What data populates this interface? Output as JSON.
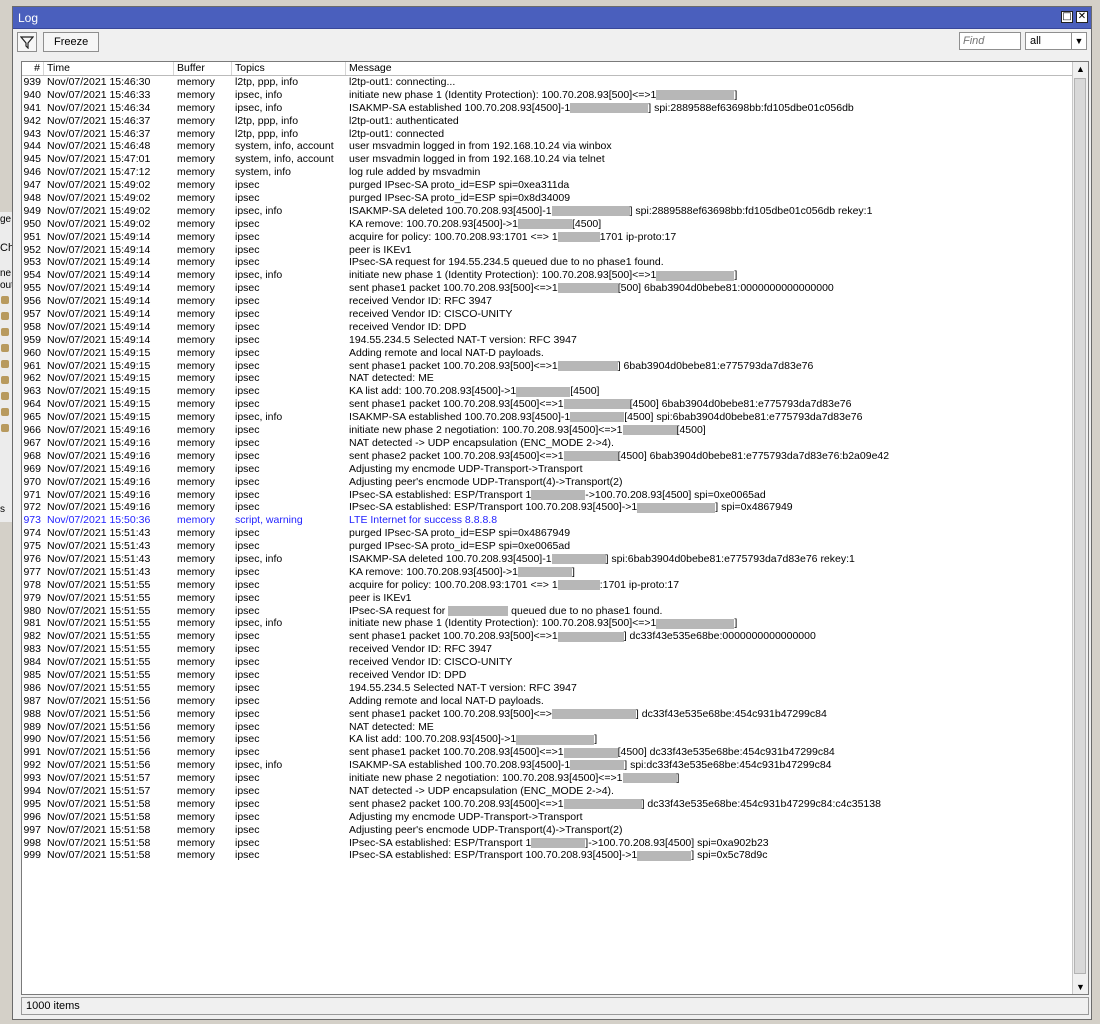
{
  "window": {
    "title": "Log",
    "close_icon": "close-icon",
    "restore_icon": "restore-icon"
  },
  "toolbar": {
    "filter_icon": "filter-icon",
    "freeze_label": "Freeze",
    "find_placeholder": "Find",
    "filter_value": "all"
  },
  "columns": [
    "#",
    "Time",
    "Buffer",
    "Topics",
    "Message"
  ],
  "status": {
    "count_text": "1000 items"
  },
  "background_strip": {
    "labels": [
      "ge",
      "Ch",
      "ne",
      "oute",
      "s"
    ]
  },
  "rows": [
    {
      "n": "939",
      "time": "Nov/07/2021 15:46:30",
      "buffer": "memory",
      "topics": "l2tp, ppp, info",
      "message": "l2tp-out1: connecting..."
    },
    {
      "n": "940",
      "time": "Nov/07/2021 15:46:33",
      "buffer": "memory",
      "topics": "ipsec, info",
      "message": "initiate new phase 1 (Identity Protection): 100.70.208.93[500]<=>1█████████████]"
    },
    {
      "n": "941",
      "time": "Nov/07/2021 15:46:34",
      "buffer": "memory",
      "topics": "ipsec, info",
      "message": "ISAKMP-SA established 100.70.208.93[4500]-1█████████████] spi:2889588ef63698bb:fd105dbe01c056db"
    },
    {
      "n": "942",
      "time": "Nov/07/2021 15:46:37",
      "buffer": "memory",
      "topics": "l2tp, ppp, info",
      "message": "l2tp-out1: authenticated"
    },
    {
      "n": "943",
      "time": "Nov/07/2021 15:46:37",
      "buffer": "memory",
      "topics": "l2tp, ppp, info",
      "message": "l2tp-out1: connected"
    },
    {
      "n": "944",
      "time": "Nov/07/2021 15:46:48",
      "buffer": "memory",
      "topics": "system, info, account",
      "message": "user msvadmin logged in from 192.168.10.24 via winbox"
    },
    {
      "n": "945",
      "time": "Nov/07/2021 15:47:01",
      "buffer": "memory",
      "topics": "system, info, account",
      "message": "user msvadmin logged in from 192.168.10.24 via telnet"
    },
    {
      "n": "946",
      "time": "Nov/07/2021 15:47:12",
      "buffer": "memory",
      "topics": "system, info",
      "message": "log rule added by msvadmin"
    },
    {
      "n": "947",
      "time": "Nov/07/2021 15:49:02",
      "buffer": "memory",
      "topics": "ipsec",
      "message": "purged IPsec-SA proto_id=ESP spi=0xea311da"
    },
    {
      "n": "948",
      "time": "Nov/07/2021 15:49:02",
      "buffer": "memory",
      "topics": "ipsec",
      "message": "purged IPsec-SA proto_id=ESP spi=0x8d34009"
    },
    {
      "n": "949",
      "time": "Nov/07/2021 15:49:02",
      "buffer": "memory",
      "topics": "ipsec, info",
      "message": "ISAKMP-SA deleted 100.70.208.93[4500]-1█████████████] spi:2889588ef63698bb:fd105dbe01c056db rekey:1"
    },
    {
      "n": "950",
      "time": "Nov/07/2021 15:49:02",
      "buffer": "memory",
      "topics": "ipsec",
      "message": "KA remove: 100.70.208.93[4500]->1█████████[4500]"
    },
    {
      "n": "951",
      "time": "Nov/07/2021 15:49:14",
      "buffer": "memory",
      "topics": "ipsec",
      "message": "acquire for policy: 100.70.208.93:1701 <=> 1███████1701 ip-proto:17"
    },
    {
      "n": "952",
      "time": "Nov/07/2021 15:49:14",
      "buffer": "memory",
      "topics": "ipsec",
      "message": "peer is IKEv1"
    },
    {
      "n": "953",
      "time": "Nov/07/2021 15:49:14",
      "buffer": "memory",
      "topics": "ipsec",
      "message": "IPsec-SA request for 194.55.234.5 queued due to no phase1 found."
    },
    {
      "n": "954",
      "time": "Nov/07/2021 15:49:14",
      "buffer": "memory",
      "topics": "ipsec, info",
      "message": "initiate new phase 1 (Identity Protection): 100.70.208.93[500]<=>1█████████████]"
    },
    {
      "n": "955",
      "time": "Nov/07/2021 15:49:14",
      "buffer": "memory",
      "topics": "ipsec",
      "message": "sent phase1 packet 100.70.208.93[500]<=>1██████████[500] 6bab3904d0bebe81:0000000000000000"
    },
    {
      "n": "956",
      "time": "Nov/07/2021 15:49:14",
      "buffer": "memory",
      "topics": "ipsec",
      "message": "received Vendor ID: RFC 3947"
    },
    {
      "n": "957",
      "time": "Nov/07/2021 15:49:14",
      "buffer": "memory",
      "topics": "ipsec",
      "message": "received Vendor ID: CISCO-UNITY"
    },
    {
      "n": "958",
      "time": "Nov/07/2021 15:49:14",
      "buffer": "memory",
      "topics": "ipsec",
      "message": "received Vendor ID: DPD"
    },
    {
      "n": "959",
      "time": "Nov/07/2021 15:49:14",
      "buffer": "memory",
      "topics": "ipsec",
      "message": "194.55.234.5 Selected NAT-T version: RFC 3947"
    },
    {
      "n": "960",
      "time": "Nov/07/2021 15:49:15",
      "buffer": "memory",
      "topics": "ipsec",
      "message": "Adding remote and local NAT-D payloads."
    },
    {
      "n": "961",
      "time": "Nov/07/2021 15:49:15",
      "buffer": "memory",
      "topics": "ipsec",
      "message": "sent phase1 packet 100.70.208.93[500]<=>1██████████] 6bab3904d0bebe81:e775793da7d83e76"
    },
    {
      "n": "962",
      "time": "Nov/07/2021 15:49:15",
      "buffer": "memory",
      "topics": "ipsec",
      "message": "NAT detected: ME"
    },
    {
      "n": "963",
      "time": "Nov/07/2021 15:49:15",
      "buffer": "memory",
      "topics": "ipsec",
      "message": "KA list add: 100.70.208.93[4500]->1█████████[4500]"
    },
    {
      "n": "964",
      "time": "Nov/07/2021 15:49:15",
      "buffer": "memory",
      "topics": "ipsec",
      "message": "sent phase1 packet 100.70.208.93[4500]<=>1███████████[4500] 6bab3904d0bebe81:e775793da7d83e76"
    },
    {
      "n": "965",
      "time": "Nov/07/2021 15:49:15",
      "buffer": "memory",
      "topics": "ipsec, info",
      "message": "ISAKMP-SA established 100.70.208.93[4500]-1█████████[4500] spi:6bab3904d0bebe81:e775793da7d83e76"
    },
    {
      "n": "966",
      "time": "Nov/07/2021 15:49:16",
      "buffer": "memory",
      "topics": "ipsec",
      "message": "initiate new phase 2 negotiation: 100.70.208.93[4500]<=>1█████████[4500]"
    },
    {
      "n": "967",
      "time": "Nov/07/2021 15:49:16",
      "buffer": "memory",
      "topics": "ipsec",
      "message": "NAT detected -> UDP encapsulation (ENC_MODE 2->4)."
    },
    {
      "n": "968",
      "time": "Nov/07/2021 15:49:16",
      "buffer": "memory",
      "topics": "ipsec",
      "message": "sent phase2 packet 100.70.208.93[4500]<=>1█████████[4500] 6bab3904d0bebe81:e775793da7d83e76:b2a09e42"
    },
    {
      "n": "969",
      "time": "Nov/07/2021 15:49:16",
      "buffer": "memory",
      "topics": "ipsec",
      "message": "Adjusting my encmode UDP-Transport->Transport"
    },
    {
      "n": "970",
      "time": "Nov/07/2021 15:49:16",
      "buffer": "memory",
      "topics": "ipsec",
      "message": "Adjusting peer's encmode UDP-Transport(4)->Transport(2)"
    },
    {
      "n": "971",
      "time": "Nov/07/2021 15:49:16",
      "buffer": "memory",
      "topics": "ipsec",
      "message": "IPsec-SA established: ESP/Transport 1█████████->100.70.208.93[4500] spi=0xe0065ad"
    },
    {
      "n": "972",
      "time": "Nov/07/2021 15:49:16",
      "buffer": "memory",
      "topics": "ipsec",
      "message": "IPsec-SA established: ESP/Transport 100.70.208.93[4500]->1█████████████] spi=0x4867949"
    },
    {
      "n": "973",
      "time": "Nov/07/2021 15:50:36",
      "buffer": "memory",
      "topics": "script, warning",
      "message": "LTE Internet for success 8.8.8.8",
      "highlight": "warn"
    },
    {
      "n": "974",
      "time": "Nov/07/2021 15:51:43",
      "buffer": "memory",
      "topics": "ipsec",
      "message": "purged IPsec-SA proto_id=ESP spi=0x4867949"
    },
    {
      "n": "975",
      "time": "Nov/07/2021 15:51:43",
      "buffer": "memory",
      "topics": "ipsec",
      "message": "purged IPsec-SA proto_id=ESP spi=0xe0065ad"
    },
    {
      "n": "976",
      "time": "Nov/07/2021 15:51:43",
      "buffer": "memory",
      "topics": "ipsec, info",
      "message": "ISAKMP-SA deleted 100.70.208.93[4500]-1█████████] spi:6bab3904d0bebe81:e775793da7d83e76 rekey:1"
    },
    {
      "n": "977",
      "time": "Nov/07/2021 15:51:43",
      "buffer": "memory",
      "topics": "ipsec",
      "message": "KA remove: 100.70.208.93[4500]->1█████████]"
    },
    {
      "n": "978",
      "time": "Nov/07/2021 15:51:55",
      "buffer": "memory",
      "topics": "ipsec",
      "message": "acquire for policy: 100.70.208.93:1701 <=> 1███████:1701 ip-proto:17"
    },
    {
      "n": "979",
      "time": "Nov/07/2021 15:51:55",
      "buffer": "memory",
      "topics": "ipsec",
      "message": "peer is IKEv1"
    },
    {
      "n": "980",
      "time": "Nov/07/2021 15:51:55",
      "buffer": "memory",
      "topics": "ipsec",
      "message": "IPsec-SA request for ██████████ queued due to no phase1 found."
    },
    {
      "n": "981",
      "time": "Nov/07/2021 15:51:55",
      "buffer": "memory",
      "topics": "ipsec, info",
      "message": "initiate new phase 1 (Identity Protection): 100.70.208.93[500]<=>1█████████████]"
    },
    {
      "n": "982",
      "time": "Nov/07/2021 15:51:55",
      "buffer": "memory",
      "topics": "ipsec",
      "message": "sent phase1 packet 100.70.208.93[500]<=>1███████████] dc33f43e535e68be:0000000000000000"
    },
    {
      "n": "983",
      "time": "Nov/07/2021 15:51:55",
      "buffer": "memory",
      "topics": "ipsec",
      "message": "received Vendor ID: RFC 3947"
    },
    {
      "n": "984",
      "time": "Nov/07/2021 15:51:55",
      "buffer": "memory",
      "topics": "ipsec",
      "message": "received Vendor ID: CISCO-UNITY"
    },
    {
      "n": "985",
      "time": "Nov/07/2021 15:51:55",
      "buffer": "memory",
      "topics": "ipsec",
      "message": "received Vendor ID: DPD"
    },
    {
      "n": "986",
      "time": "Nov/07/2021 15:51:55",
      "buffer": "memory",
      "topics": "ipsec",
      "message": "194.55.234.5 Selected NAT-T version: RFC 3947"
    },
    {
      "n": "987",
      "time": "Nov/07/2021 15:51:56",
      "buffer": "memory",
      "topics": "ipsec",
      "message": "Adding remote and local NAT-D payloads."
    },
    {
      "n": "988",
      "time": "Nov/07/2021 15:51:56",
      "buffer": "memory",
      "topics": "ipsec",
      "message": "sent phase1 packet 100.70.208.93[500]<=>██████████████] dc33f43e535e68be:454c931b47299c84"
    },
    {
      "n": "989",
      "time": "Nov/07/2021 15:51:56",
      "buffer": "memory",
      "topics": "ipsec",
      "message": "NAT detected: ME"
    },
    {
      "n": "990",
      "time": "Nov/07/2021 15:51:56",
      "buffer": "memory",
      "topics": "ipsec",
      "message": "KA list add: 100.70.208.93[4500]->1█████████████]"
    },
    {
      "n": "991",
      "time": "Nov/07/2021 15:51:56",
      "buffer": "memory",
      "topics": "ipsec",
      "message": "sent phase1 packet 100.70.208.93[4500]<=>1█████████[4500] dc33f43e535e68be:454c931b47299c84"
    },
    {
      "n": "992",
      "time": "Nov/07/2021 15:51:56",
      "buffer": "memory",
      "topics": "ipsec, info",
      "message": "ISAKMP-SA established 100.70.208.93[4500]-1█████████] spi:dc33f43e535e68be:454c931b47299c84"
    },
    {
      "n": "993",
      "time": "Nov/07/2021 15:51:57",
      "buffer": "memory",
      "topics": "ipsec",
      "message": "initiate new phase 2 negotiation: 100.70.208.93[4500]<=>1█████████]"
    },
    {
      "n": "994",
      "time": "Nov/07/2021 15:51:57",
      "buffer": "memory",
      "topics": "ipsec",
      "message": "NAT detected -> UDP encapsulation (ENC_MODE 2->4)."
    },
    {
      "n": "995",
      "time": "Nov/07/2021 15:51:58",
      "buffer": "memory",
      "topics": "ipsec",
      "message": "sent phase2 packet 100.70.208.93[4500]<=>1█████████████] dc33f43e535e68be:454c931b47299c84:c4c35138"
    },
    {
      "n": "996",
      "time": "Nov/07/2021 15:51:58",
      "buffer": "memory",
      "topics": "ipsec",
      "message": "Adjusting my encmode UDP-Transport->Transport"
    },
    {
      "n": "997",
      "time": "Nov/07/2021 15:51:58",
      "buffer": "memory",
      "topics": "ipsec",
      "message": "Adjusting peer's encmode UDP-Transport(4)->Transport(2)"
    },
    {
      "n": "998",
      "time": "Nov/07/2021 15:51:58",
      "buffer": "memory",
      "topics": "ipsec",
      "message": "IPsec-SA established: ESP/Transport 1█████████]->100.70.208.93[4500] spi=0xa902b23"
    },
    {
      "n": "999",
      "time": "Nov/07/2021 15:51:58",
      "buffer": "memory",
      "topics": "ipsec",
      "message": "IPsec-SA established: ESP/Transport 100.70.208.93[4500]->1█████████] spi=0x5c78d9c"
    }
  ]
}
